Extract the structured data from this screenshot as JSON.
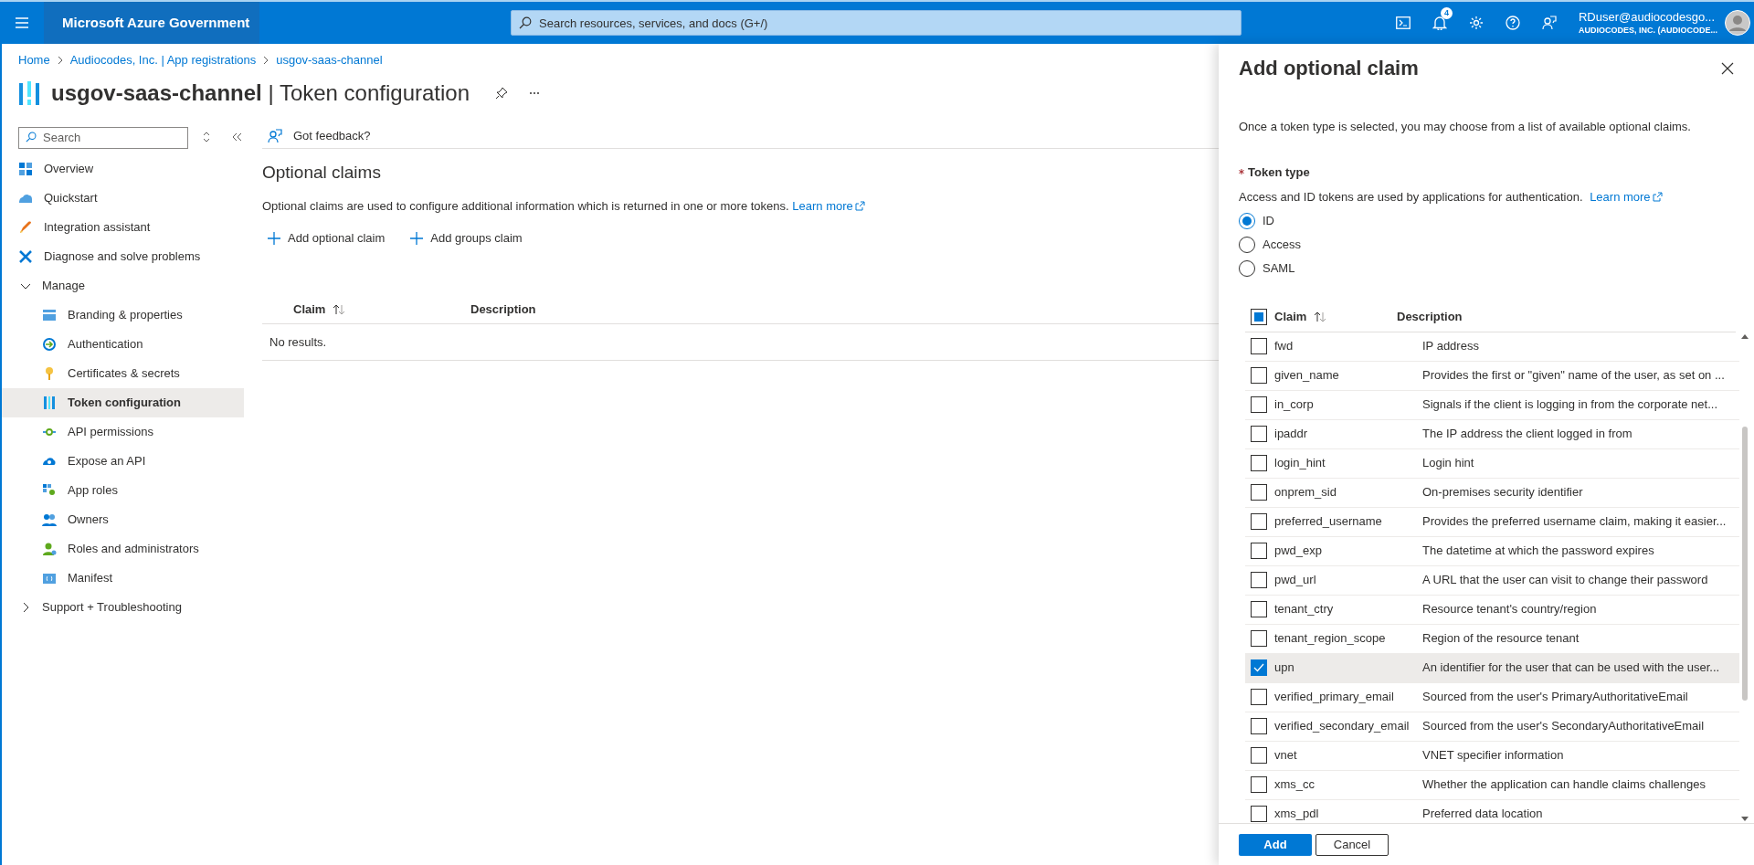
{
  "top_bar": {
    "brand": "Microsoft Azure Government",
    "search": {
      "placeholder": "Search resources, services, and docs (G+/)"
    },
    "notifications_count": "4",
    "user": {
      "name": "RDuser@audiocodesgo...",
      "tenant": "AUDIOCODES, INC. (AUDIOCODE..."
    }
  },
  "breadcrumb": [
    "Home",
    "Audiocodes, Inc. | App registrations",
    "usgov-saas-channel"
  ],
  "page_title": {
    "resource": "usgov-saas-channel",
    "section": "| Token configuration"
  },
  "sidebar": {
    "search": {
      "placeholder": "Search"
    },
    "items": [
      {
        "kind": "item",
        "label": "Overview",
        "selected": false
      },
      {
        "kind": "item",
        "label": "Quickstart",
        "selected": false
      },
      {
        "kind": "item",
        "label": "Integration assistant",
        "selected": false
      },
      {
        "kind": "item",
        "label": "Diagnose and solve problems",
        "selected": false
      },
      {
        "kind": "group",
        "label": "Manage",
        "expanded": true,
        "children": [
          {
            "label": "Branding & properties",
            "selected": false
          },
          {
            "label": "Authentication",
            "selected": false
          },
          {
            "label": "Certificates & secrets",
            "selected": false
          },
          {
            "label": "Token configuration",
            "selected": true
          },
          {
            "label": "API permissions",
            "selected": false
          },
          {
            "label": "Expose an API",
            "selected": false
          },
          {
            "label": "App roles",
            "selected": false
          },
          {
            "label": "Owners",
            "selected": false
          },
          {
            "label": "Roles and administrators",
            "selected": false
          },
          {
            "label": "Manifest",
            "selected": false
          }
        ]
      },
      {
        "kind": "group",
        "label": "Support + Troubleshooting",
        "expanded": false
      }
    ]
  },
  "main": {
    "feedback": "Got feedback?",
    "title": "Optional claims",
    "description": "Optional claims are used to configure additional information which is returned in one or more tokens.",
    "learn_more": "Learn more",
    "actions": [
      "Add optional claim",
      "Add groups claim"
    ],
    "table": {
      "columns": [
        "Claim",
        "Description"
      ],
      "empty": "No results."
    }
  },
  "panel": {
    "title": "Add optional claim",
    "intro": "Once a token type is selected, you may choose from a list of available optional claims.",
    "token_type": {
      "label": "Token type",
      "hint": "Access and ID tokens are used by applications for authentication.",
      "learn_more": "Learn more",
      "options": [
        {
          "label": "ID",
          "selected": true
        },
        {
          "label": "Access",
          "selected": false
        },
        {
          "label": "SAML",
          "selected": false
        }
      ]
    },
    "table": {
      "select_all": {
        "checked": false,
        "indeterminate": true
      },
      "columns": [
        "Claim",
        "Description"
      ],
      "rows": [
        {
          "claim": "fwd",
          "description": "IP address",
          "checked": false,
          "selected": false
        },
        {
          "claim": "given_name",
          "description": "Provides the first or \"given\" name of the user, as set on ...",
          "checked": false,
          "selected": false
        },
        {
          "claim": "in_corp",
          "description": "Signals if the client is logging in from the corporate net...",
          "checked": false,
          "selected": false
        },
        {
          "claim": "ipaddr",
          "description": "The IP address the client logged in from",
          "checked": false,
          "selected": false
        },
        {
          "claim": "login_hint",
          "description": "Login hint",
          "checked": false,
          "selected": false
        },
        {
          "claim": "onprem_sid",
          "description": "On-premises security identifier",
          "checked": false,
          "selected": false
        },
        {
          "claim": "preferred_username",
          "description": "Provides the preferred username claim, making it easier...",
          "checked": false,
          "selected": false
        },
        {
          "claim": "pwd_exp",
          "description": "The datetime at which the password expires",
          "checked": false,
          "selected": false
        },
        {
          "claim": "pwd_url",
          "description": "A URL that the user can visit to change their password",
          "checked": false,
          "selected": false
        },
        {
          "claim": "tenant_ctry",
          "description": "Resource tenant's country/region",
          "checked": false,
          "selected": false
        },
        {
          "claim": "tenant_region_scope",
          "description": "Region of the resource tenant",
          "checked": false,
          "selected": false
        },
        {
          "claim": "upn",
          "description": "An identifier for the user that can be used with the user...",
          "checked": true,
          "selected": true
        },
        {
          "claim": "verified_primary_email",
          "description": "Sourced from the user's PrimaryAuthoritativeEmail",
          "checked": false,
          "selected": false
        },
        {
          "claim": "verified_secondary_email",
          "description": "Sourced from the user's SecondaryAuthoritativeEmail",
          "checked": false,
          "selected": false
        },
        {
          "claim": "vnet",
          "description": "VNET specifier information",
          "checked": false,
          "selected": false
        },
        {
          "claim": "xms_cc",
          "description": "Whether the application can handle claims challenges",
          "checked": false,
          "selected": false
        },
        {
          "claim": "xms_pdl",
          "description": "Preferred data location",
          "checked": false,
          "selected": false
        }
      ]
    },
    "buttons": [
      "Add",
      "Cancel"
    ]
  }
}
